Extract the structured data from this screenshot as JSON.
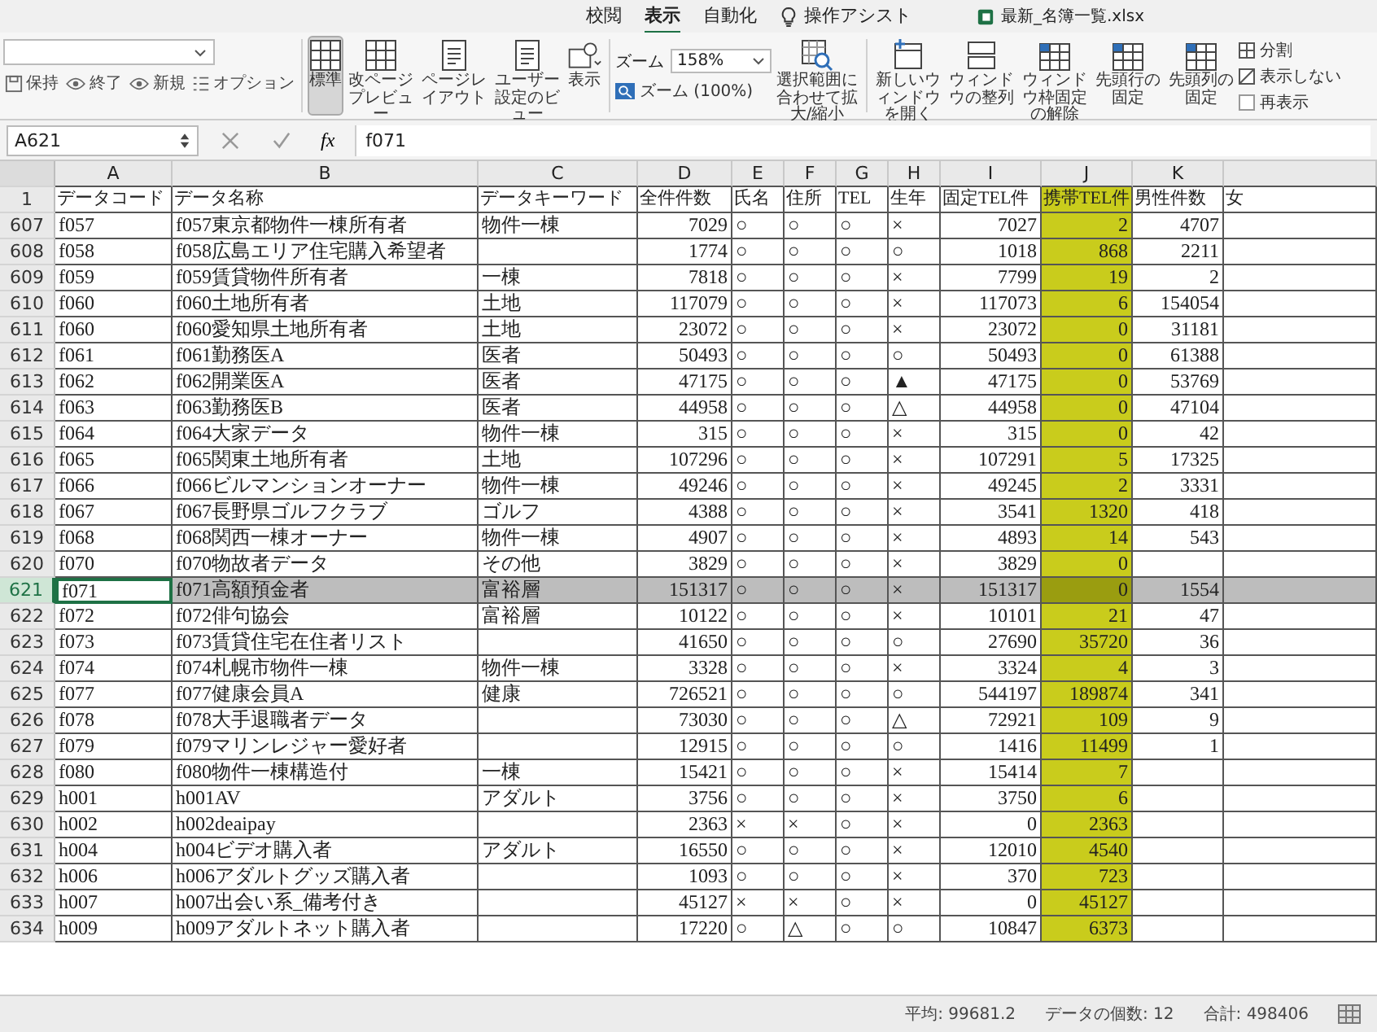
{
  "title_bar": {
    "tabs": [
      {
        "label": "校閲",
        "selected": false
      },
      {
        "label": "表示",
        "selected": true
      },
      {
        "label": "自動化",
        "selected": false
      },
      {
        "label": "操作アシスト",
        "selected": false
      }
    ],
    "file_name": "最新_名簿一覧.xlsx"
  },
  "ribbon": {
    "sheet_view": [
      {
        "label": "保持",
        "kind": "save"
      },
      {
        "label": "終了",
        "kind": "eye"
      },
      {
        "label": "新規",
        "kind": "eye"
      },
      {
        "label": "オプション",
        "kind": "list"
      }
    ],
    "buttons": [
      {
        "label": "標準",
        "kind": "grid",
        "selected": true
      },
      {
        "label": "改ページプレビュー",
        "kind": "grid",
        "selected": false
      },
      {
        "label": "ページレイアウト",
        "kind": "page",
        "selected": false
      },
      {
        "label": "ユーザー設定のビュー",
        "kind": "page",
        "selected": false
      },
      {
        "label": "表示",
        "kind": "shapes",
        "selected": false
      }
    ],
    "zoom": {
      "label": "ズーム",
      "value": "158%",
      "reset": "ズーム (100%)"
    },
    "window_buttons": [
      {
        "label": "選択範囲に合わせて拡大/縮小",
        "kind": "zoom"
      },
      {
        "label": "新しいウィンドウを開く",
        "kind": "window"
      },
      {
        "label": "ウィンドウの整列",
        "kind": "arrange"
      },
      {
        "label": "ウィンドウ枠固定の解除",
        "kind": "freeze"
      },
      {
        "label": "先頭行の固定",
        "kind": "freeze"
      },
      {
        "label": "先頭列の固定",
        "kind": "freeze"
      }
    ],
    "window_options": [
      {
        "label": "分割",
        "kind": "split"
      },
      {
        "label": "表示しない",
        "kind": "hide"
      },
      {
        "label": "再表示",
        "kind": "show"
      }
    ]
  },
  "formula_bar": {
    "name_box": "A621",
    "fx": "fx",
    "formula": "f071"
  },
  "sheet": {
    "header_row": "1",
    "columns": [
      {
        "letter": "A",
        "header": "データコード",
        "kind": "text",
        "highlight": false
      },
      {
        "letter": "B",
        "header": "データ名称",
        "kind": "text",
        "highlight": false
      },
      {
        "letter": "C",
        "header": "データキーワード",
        "kind": "text",
        "highlight": false
      },
      {
        "letter": "D",
        "header": "全件件数",
        "kind": "number",
        "highlight": false
      },
      {
        "letter": "E",
        "header": "氏名",
        "kind": "mark",
        "highlight": false
      },
      {
        "letter": "F",
        "header": "住所",
        "kind": "mark",
        "highlight": false
      },
      {
        "letter": "G",
        "header": "TEL",
        "kind": "mark",
        "highlight": false
      },
      {
        "letter": "H",
        "header": "生年",
        "kind": "mark",
        "highlight": false
      },
      {
        "letter": "I",
        "header": "固定TEL件",
        "kind": "number",
        "highlight": false
      },
      {
        "letter": "J",
        "header": "携帯TEL件",
        "kind": "number",
        "highlight": true
      },
      {
        "letter": "K",
        "header": "男性件数",
        "kind": "number",
        "highlight": false
      },
      {
        "header": "女",
        "kind": "number",
        "highlight": false
      }
    ],
    "rows": [
      {
        "number": "607",
        "selected": false,
        "cells": [
          "f057",
          "f057東京都物件一棟所有者",
          "物件一棟",
          "7029",
          "○",
          "○",
          "○",
          "×",
          "7027",
          "2",
          "4707"
        ]
      },
      {
        "number": "608",
        "selected": false,
        "cells": [
          "f058",
          "f058広島エリア住宅購入希望者",
          "",
          "1774",
          "○",
          "○",
          "○",
          "○",
          "1018",
          "868",
          "2211"
        ]
      },
      {
        "number": "609",
        "selected": false,
        "cells": [
          "f059",
          "f059賃貸物件所有者",
          "一棟",
          "7818",
          "○",
          "○",
          "○",
          "×",
          "7799",
          "19",
          "2"
        ]
      },
      {
        "number": "610",
        "selected": false,
        "cells": [
          "f060",
          "f060土地所有者",
          "土地",
          "117079",
          "○",
          "○",
          "○",
          "×",
          "117073",
          "6",
          "154054"
        ]
      },
      {
        "number": "611",
        "selected": false,
        "cells": [
          "f060",
          "f060愛知県土地所有者",
          "土地",
          "23072",
          "○",
          "○",
          "○",
          "×",
          "23072",
          "0",
          "31181"
        ]
      },
      {
        "number": "612",
        "selected": false,
        "cells": [
          "f061",
          "f061勤務医A",
          "医者",
          "50493",
          "○",
          "○",
          "○",
          "○",
          "50493",
          "0",
          "61388"
        ]
      },
      {
        "number": "613",
        "selected": false,
        "cells": [
          "f062",
          "f062開業医A",
          "医者",
          "47175",
          "○",
          "○",
          "○",
          "▲",
          "47175",
          "0",
          "53769"
        ]
      },
      {
        "number": "614",
        "selected": false,
        "cells": [
          "f063",
          "f063勤務医B",
          "医者",
          "44958",
          "○",
          "○",
          "○",
          "△",
          "44958",
          "0",
          "47104"
        ]
      },
      {
        "number": "615",
        "selected": false,
        "cells": [
          "f064",
          "f064大家データ",
          "物件一棟",
          "315",
          "○",
          "○",
          "○",
          "×",
          "315",
          "0",
          "42"
        ]
      },
      {
        "number": "616",
        "selected": false,
        "cells": [
          "f065",
          "f065関東土地所有者",
          "土地",
          "107296",
          "○",
          "○",
          "○",
          "×",
          "107291",
          "5",
          "17325"
        ]
      },
      {
        "number": "617",
        "selected": false,
        "cells": [
          "f066",
          "f066ビルマンションオーナー",
          "物件一棟",
          "49246",
          "○",
          "○",
          "○",
          "×",
          "49245",
          "2",
          "3331"
        ]
      },
      {
        "number": "618",
        "selected": false,
        "cells": [
          "f067",
          "f067長野県ゴルフクラブ",
          "ゴルフ",
          "4388",
          "○",
          "○",
          "○",
          "×",
          "3541",
          "1320",
          "418"
        ]
      },
      {
        "number": "619",
        "selected": false,
        "cells": [
          "f068",
          "f068関西一棟オーナー",
          "物件一棟",
          "4907",
          "○",
          "○",
          "○",
          "×",
          "4893",
          "14",
          "543"
        ]
      },
      {
        "number": "620",
        "selected": false,
        "cells": [
          "f070",
          "f070物故者データ",
          "その他",
          "3829",
          "○",
          "○",
          "○",
          "×",
          "3829",
          "0",
          ""
        ]
      },
      {
        "number": "621",
        "selected": true,
        "cells": [
          "f071",
          "f071高額預金者",
          "富裕層",
          "151317",
          "○",
          "○",
          "○",
          "×",
          "151317",
          "0",
          "1554"
        ]
      },
      {
        "number": "622",
        "selected": false,
        "cells": [
          "f072",
          "f072俳句協会",
          "富裕層",
          "10122",
          "○",
          "○",
          "○",
          "×",
          "10101",
          "21",
          "47"
        ]
      },
      {
        "number": "623",
        "selected": false,
        "cells": [
          "f073",
          "f073賃貸住宅在住者リスト",
          "",
          "41650",
          "○",
          "○",
          "○",
          "○",
          "27690",
          "35720",
          "36"
        ]
      },
      {
        "number": "624",
        "selected": false,
        "cells": [
          "f074",
          "f074札幌市物件一棟",
          "物件一棟",
          "3328",
          "○",
          "○",
          "○",
          "×",
          "3324",
          "4",
          "3"
        ]
      },
      {
        "number": "625",
        "selected": false,
        "cells": [
          "f077",
          "f077健康会員A",
          "健康",
          "726521",
          "○",
          "○",
          "○",
          "○",
          "544197",
          "189874",
          "341"
        ]
      },
      {
        "number": "626",
        "selected": false,
        "cells": [
          "f078",
          "f078大手退職者データ",
          "",
          "73030",
          "○",
          "○",
          "○",
          "△",
          "72921",
          "109",
          "9"
        ]
      },
      {
        "number": "627",
        "selected": false,
        "cells": [
          "f079",
          "f079マリンレジャー愛好者",
          "",
          "12915",
          "○",
          "○",
          "○",
          "○",
          "1416",
          "11499",
          "1"
        ]
      },
      {
        "number": "628",
        "selected": false,
        "cells": [
          "f080",
          "f080物件一棟構造付",
          "一棟",
          "15421",
          "○",
          "○",
          "○",
          "×",
          "15414",
          "7",
          ""
        ]
      },
      {
        "number": "629",
        "selected": false,
        "cells": [
          "h001",
          "h001AV",
          "アダルト",
          "3756",
          "○",
          "○",
          "○",
          "×",
          "3750",
          "6",
          ""
        ]
      },
      {
        "number": "630",
        "selected": false,
        "cells": [
          "h002",
          "h002deaipay",
          "",
          "2363",
          "×",
          "×",
          "○",
          "×",
          "0",
          "2363",
          ""
        ]
      },
      {
        "number": "631",
        "selected": false,
        "cells": [
          "h004",
          "h004ビデオ購入者",
          "アダルト",
          "16550",
          "○",
          "○",
          "○",
          "×",
          "12010",
          "4540",
          ""
        ]
      },
      {
        "number": "632",
        "selected": false,
        "cells": [
          "h006",
          "h006アダルトグッズ購入者",
          "",
          "1093",
          "○",
          "○",
          "○",
          "×",
          "370",
          "723",
          ""
        ]
      },
      {
        "number": "633",
        "selected": false,
        "cells": [
          "h007",
          "h007出会い系_備考付き",
          "",
          "45127",
          "×",
          "×",
          "○",
          "×",
          "0",
          "45127",
          ""
        ]
      },
      {
        "number": "634",
        "selected": false,
        "cells": [
          "h009",
          "h009アダルトネット購入者",
          "",
          "17220",
          "○",
          "△",
          "○",
          "○",
          "10847",
          "6373",
          ""
        ]
      }
    ]
  },
  "status_bar": {
    "items": [
      "平均: 99681.2",
      "データの個数: 12",
      "合計: 498406"
    ]
  }
}
